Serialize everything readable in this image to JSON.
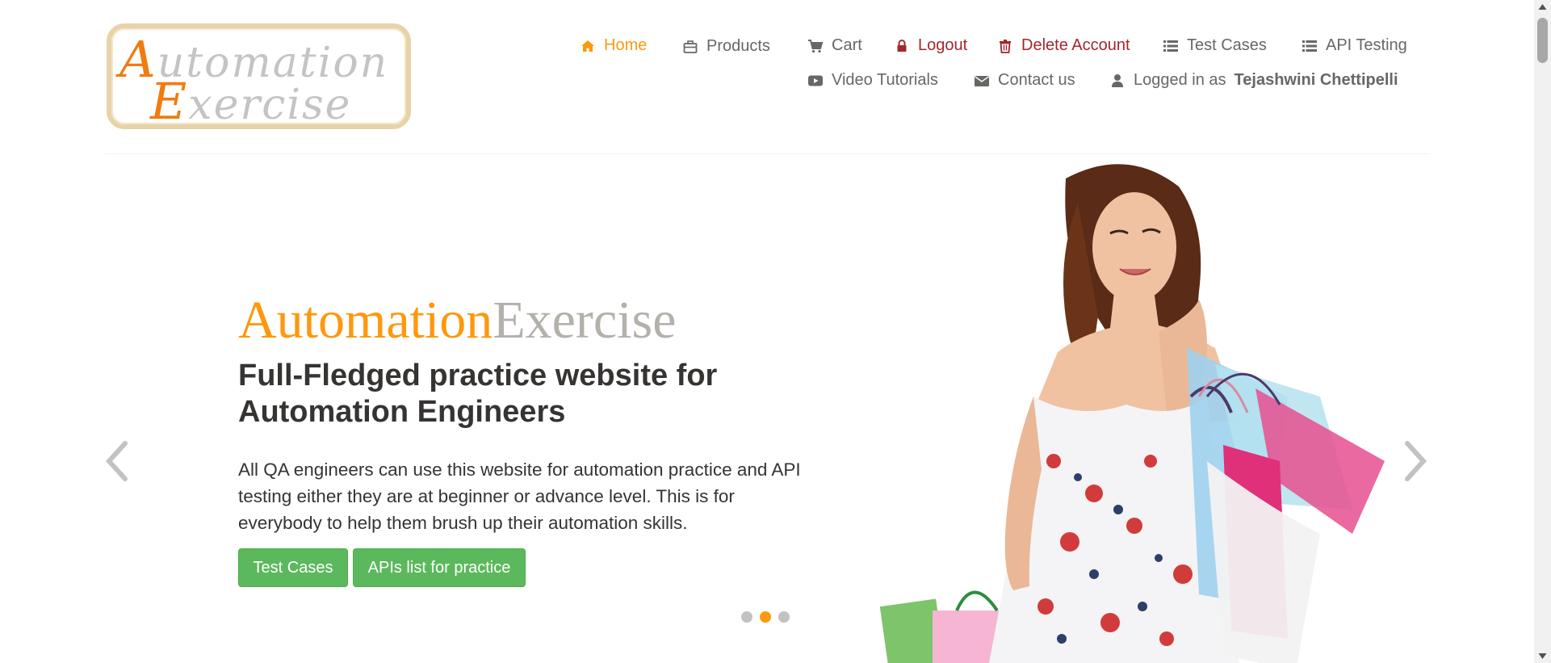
{
  "header": {
    "logo": {
      "line1": "Automation",
      "line2": "Exercise"
    },
    "nav": {
      "home": "Home",
      "products": "Products",
      "cart": "Cart",
      "logout": "Logout",
      "delete_account": "Delete Account",
      "test_cases": "Test Cases",
      "api_testing": "API Testing",
      "video_tutorials": "Video Tutorials",
      "contact_us": "Contact us",
      "logged_in_prefix": "Logged in as",
      "logged_in_user": "Tejashwini Chettipelli"
    },
    "icons": {
      "home": "home-icon",
      "products": "products-icon",
      "cart": "cart-icon",
      "logout": "lock-icon",
      "delete_account": "trash-icon",
      "test_cases": "list-icon",
      "api_testing": "list-icon",
      "video_tutorials": "youtube-icon",
      "contact_us": "envelope-icon",
      "logged_in": "user-icon"
    }
  },
  "slider": {
    "title_part1": "Automation",
    "title_part2": "Exercise",
    "subtitle_line1": "Full-Fledged practice website for",
    "subtitle_line2": "Automation Engineers",
    "description": "All QA engineers can use this website for automation practice and API testing either they are at beginner or advance level. This is for everybody to help them brush up their automation skills.",
    "button_test_cases": "Test Cases",
    "button_apis": "APIs list for practice",
    "indicators": 3,
    "active_indicator": 2
  },
  "colors": {
    "accent": "#fe980f",
    "danger": "#a5272b",
    "text": "#696763",
    "heading": "#363432",
    "button": "#5cb85c",
    "logo_border": "#e8d3a9"
  }
}
